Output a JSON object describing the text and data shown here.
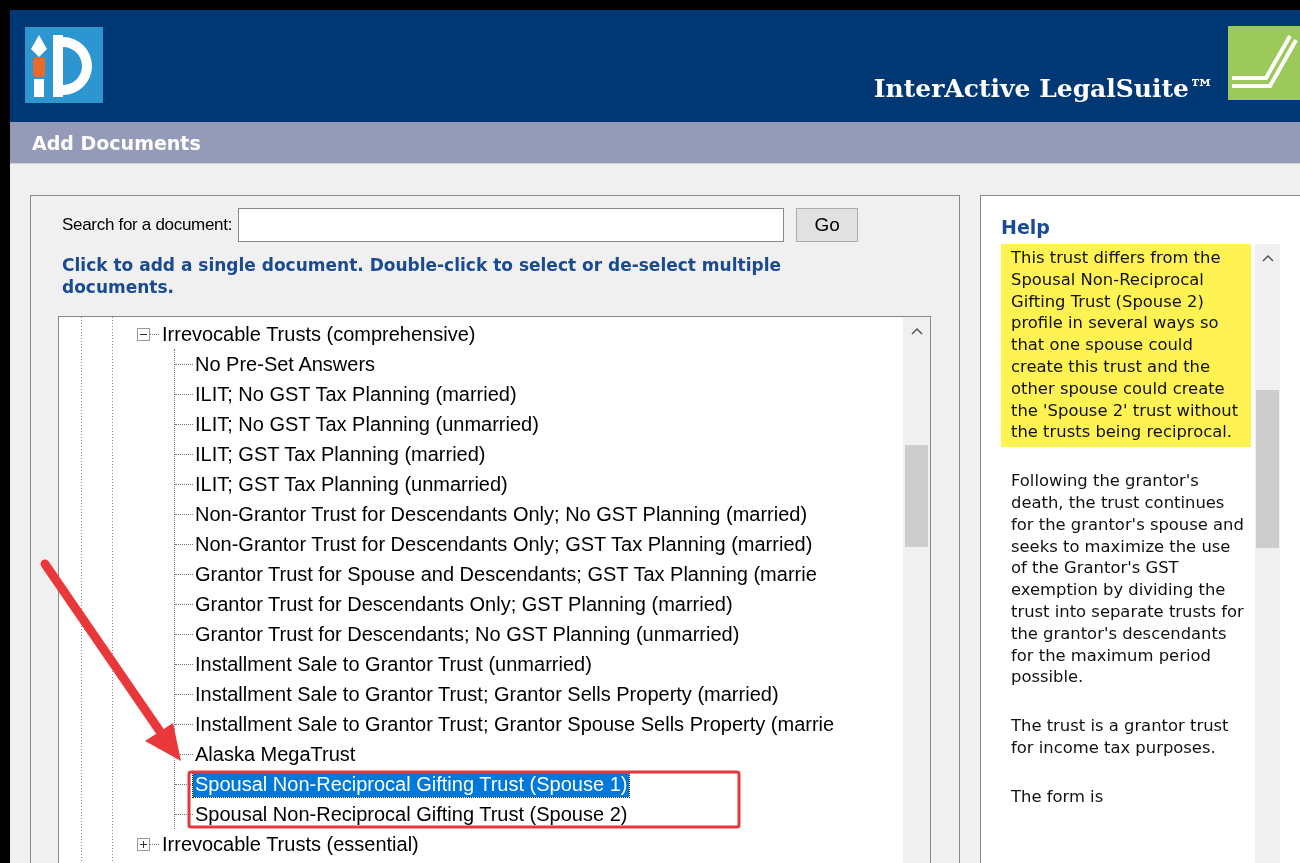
{
  "header": {
    "product_name": "InterActive LegalSuite™"
  },
  "page_title": "Add Documents",
  "search": {
    "label": "Search for a document:",
    "button": "Go"
  },
  "instructions": "Click to add a single document. Double-click to select or de-select multiple documents.",
  "tree": {
    "items": [
      {
        "label": "Irrevocable Trusts (comprehensive)",
        "expanded": true,
        "children": [
          {
            "label": "No Pre-Set Answers",
            "selected": false
          },
          {
            "label": "ILIT; No GST Tax Planning (married)",
            "selected": false
          },
          {
            "label": "ILIT; No GST Tax Planning (unmarried)",
            "selected": false
          },
          {
            "label": "ILIT; GST Tax Planning (married)",
            "selected": false
          },
          {
            "label": "ILIT; GST Tax Planning (unmarried)",
            "selected": false
          },
          {
            "label": "Non-Grantor Trust for Descendants Only; No GST Planning (married)",
            "selected": false
          },
          {
            "label": "Non-Grantor Trust for Descendants Only; GST Tax Planning (married)",
            "selected": false
          },
          {
            "label": "Grantor Trust for Spouse and Descendants; GST Tax Planning  (marrie",
            "selected": false
          },
          {
            "label": "Grantor Trust for Descendants Only; GST Planning (married)",
            "selected": false
          },
          {
            "label": "Grantor Trust for Descendants; No GST Planning (unmarried)",
            "selected": false
          },
          {
            "label": "Installment Sale to Grantor Trust (unmarried)",
            "selected": false
          },
          {
            "label": "Installment Sale to Grantor Trust; Grantor Sells Property (married)",
            "selected": false
          },
          {
            "label": "Installment Sale to Grantor Trust; Grantor Spouse Sells Property (marrie",
            "selected": false
          },
          {
            "label": "Alaska MegaTrust",
            "selected": false
          },
          {
            "label": "Spousal Non-Reciprocal Gifting Trust (Spouse 1)",
            "selected": true
          },
          {
            "label": "Spousal Non-Reciprocal Gifting Trust (Spouse 2)",
            "selected": false
          }
        ]
      },
      {
        "label": "Irrevocable Trusts (essential)",
        "expanded": false
      }
    ]
  },
  "help": {
    "title": "Help",
    "paragraphs": [
      {
        "text": "This trust differs from the Spousal Non-Reciprocal Gifting Trust (Spouse 2) profile in several ways so that one spouse could create this trust and the other spouse could create the 'Spouse 2' trust without the trusts being reciprocal.",
        "highlighted": true
      },
      {
        "text": "Following the grantor's death, the trust continues for the grantor's spouse and seeks to maximize the use of the Grantor's GST exemption by dividing the trust into separate trusts for the grantor's descendants for the maximum period possible.",
        "highlighted": false
      },
      {
        "text": "The trust is a grantor trust for income tax purposes.",
        "highlighted": false
      },
      {
        "text": "The form is",
        "highlighted": false
      }
    ]
  }
}
